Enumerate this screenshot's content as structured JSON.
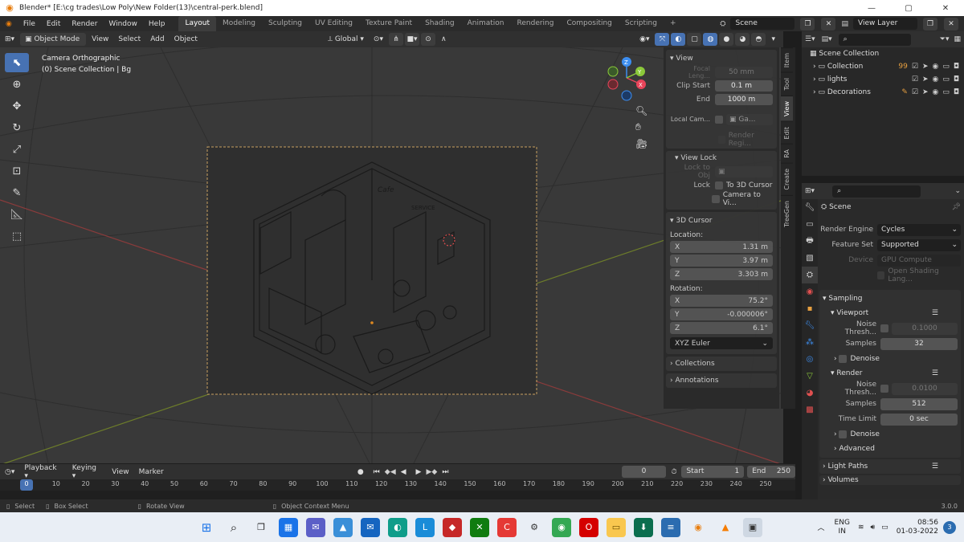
{
  "titlebar": {
    "title": "Blender* [E:\\cg trades\\Low Poly\\New Folder(13)\\central-perk.blend]",
    "minimize": "—",
    "maximize": "▢",
    "close": "✕"
  },
  "menubar": {
    "menus": [
      "File",
      "Edit",
      "Render",
      "Window",
      "Help"
    ],
    "workspaces": [
      "Layout",
      "Modeling",
      "Sculpting",
      "UV Editing",
      "Texture Paint",
      "Shading",
      "Animation",
      "Rendering",
      "Compositing",
      "Scripting"
    ],
    "active_workspace": "Layout",
    "add_tab": "+",
    "scene": "Scene",
    "view_layer": "View Layer"
  },
  "viewport_header": {
    "mode": "Object Mode",
    "menus": [
      "View",
      "Select",
      "Add",
      "Object"
    ],
    "transform": "Global"
  },
  "viewport": {
    "camera_label": "Camera Orthographic",
    "collection_label": "(0) Scene Collection | Bg",
    "sign_text_1": "Cafe",
    "sign_text_2": "SERVICE"
  },
  "npanel": {
    "view_header": "View",
    "focal_length_label": "Focal Leng...",
    "focal_length": "50 mm",
    "clip_start_label": "Clip Start",
    "clip_start": "0.1 m",
    "clip_end_label": "End",
    "clip_end": "1000 m",
    "local_camera_label": "Local Cam...",
    "local_camera_value": "Ga...",
    "render_region": "Render Regi...",
    "view_lock_header": "View Lock",
    "lock_to_obj_label": "Lock to Obj",
    "lock_label": "Lock",
    "to_3d_cursor": "To 3D Cursor",
    "camera_to_view": "Camera to Vi...",
    "cursor_header": "3D Cursor",
    "location_label": "Location:",
    "loc_x": "1.31 m",
    "loc_y": "3.97 m",
    "loc_z": "3.303 m",
    "rotation_label": "Rotation:",
    "rot_x": "75.2°",
    "rot_y": "-0.000006°",
    "rot_z": "6.1°",
    "rotation_mode": "XYZ Euler",
    "collections_header": "Collections",
    "annotations_header": "Annotations",
    "axis_labels": [
      "X",
      "Y",
      "Z"
    ],
    "tabs": [
      "Item",
      "Tool",
      "View",
      "Edit",
      "RA",
      "Create",
      "TreeGen"
    ]
  },
  "outliner": {
    "root": "Scene Collection",
    "items": [
      {
        "name": "Collection",
        "badge": "99"
      },
      {
        "name": "lights",
        "badge": ""
      },
      {
        "name": "Decorations",
        "badge": ""
      }
    ]
  },
  "properties": {
    "context": "Scene",
    "render_engine_label": "Render Engine",
    "render_engine": "Cycles",
    "feature_set_label": "Feature Set",
    "feature_set": "Supported",
    "device_label": "Device",
    "device": "GPU Compute",
    "open_shading": "Open Shading Lang...",
    "sampling_header": "Sampling",
    "viewport_header": "Viewport",
    "noise_threshold_label": "Noise Thresh...",
    "vp_noise_threshold": "0.1000",
    "samples_label": "Samples",
    "vp_samples": "32",
    "denoise_label": "Denoise",
    "render_header": "Render",
    "r_noise_threshold": "0.0100",
    "r_samples": "512",
    "time_limit_label": "Time Limit",
    "time_limit": "0 sec",
    "advanced_header": "Advanced",
    "light_paths_header": "Light Paths",
    "volumes_header": "Volumes"
  },
  "timeline": {
    "menus": [
      "Playback",
      "Keying",
      "View",
      "Marker"
    ],
    "current_frame": "0",
    "start_label": "Start",
    "start": "1",
    "end_label": "End",
    "end": "250",
    "ticks": [
      "0",
      "10",
      "20",
      "30",
      "40",
      "50",
      "60",
      "70",
      "80",
      "90",
      "100",
      "110",
      "120",
      "130",
      "140",
      "150",
      "160",
      "170",
      "180",
      "190",
      "200",
      "210",
      "220",
      "230",
      "240",
      "250"
    ]
  },
  "statusbar": {
    "select": "Select",
    "box_select": "Box Select",
    "rotate_view": "Rotate View",
    "context_menu": "Object Context Menu",
    "version": "3.0.0"
  },
  "taskbar": {
    "language": "ENG",
    "region": "IN",
    "time": "08:56",
    "date": "01-03-2022",
    "notifications": "3"
  },
  "colors": {
    "accent_blue": "#4772b3",
    "blender_orange": "#e87d0d",
    "x_axis": "#e8445a",
    "y_axis": "#8bc83a",
    "z_axis": "#3d8ef0"
  }
}
